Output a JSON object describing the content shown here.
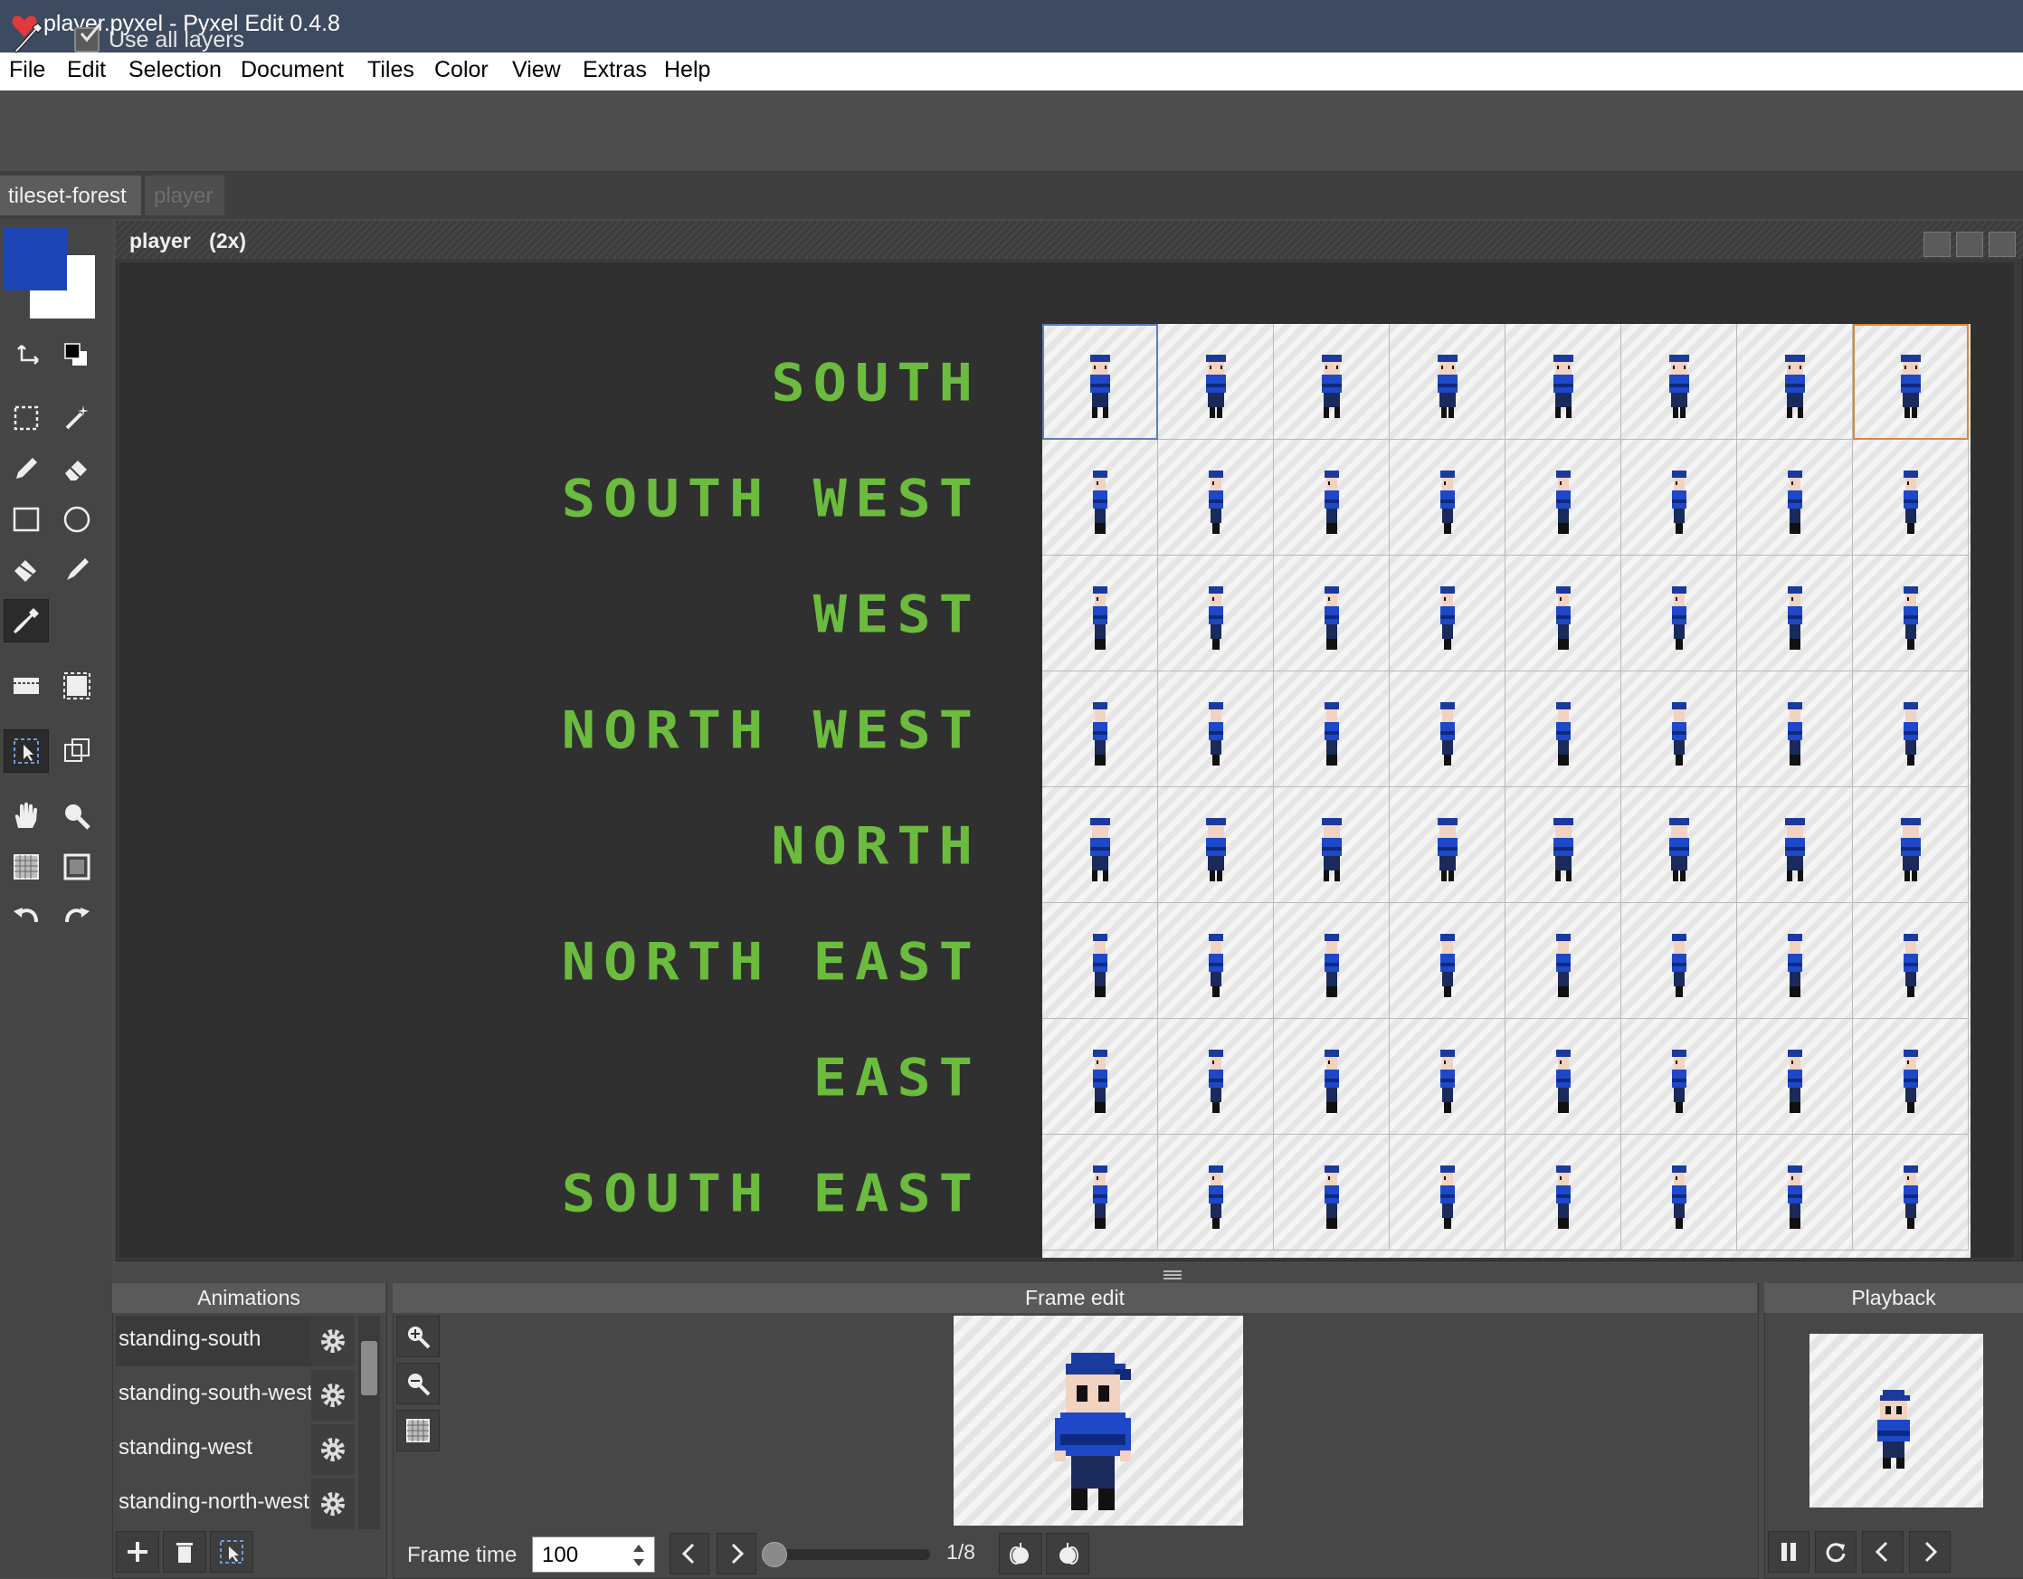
{
  "window": {
    "title": "player.pyxel - Pyxel Edit 0.4.8"
  },
  "menu": [
    "File",
    "Edit",
    "Selection",
    "Document",
    "Tiles",
    "Color",
    "View",
    "Extras",
    "Help"
  ],
  "toolbar": {
    "use_all_layers_label": "Use all layers",
    "use_all_layers_checked": true
  },
  "tabs": [
    {
      "label": "tileset-forest",
      "active": true
    },
    {
      "label": "player",
      "active": false
    }
  ],
  "colors": {
    "primary": "#1c44b4",
    "secondary": "#ffffff",
    "label_green": "#6bbb3e",
    "titlebar": "#3e4a60"
  },
  "canvas": {
    "title": "player",
    "zoom": "(2x)",
    "direction_labels": [
      "SOUTH",
      "SOUTH WEST",
      "WEST",
      "NORTH WEST",
      "NORTH",
      "NORTH EAST",
      "EAST",
      "SOUTH EAST"
    ],
    "grid_columns": 8,
    "grid_rows": 8
  },
  "animations": {
    "header": "Animations",
    "items": [
      "standing-south",
      "standing-south-west",
      "standing-west",
      "standing-north-west"
    ]
  },
  "frame_edit": {
    "header": "Frame edit",
    "frame_time_label": "Frame time",
    "frame_time_value": "100",
    "frame_counter": "1/8"
  },
  "playback": {
    "header": "Playback"
  }
}
